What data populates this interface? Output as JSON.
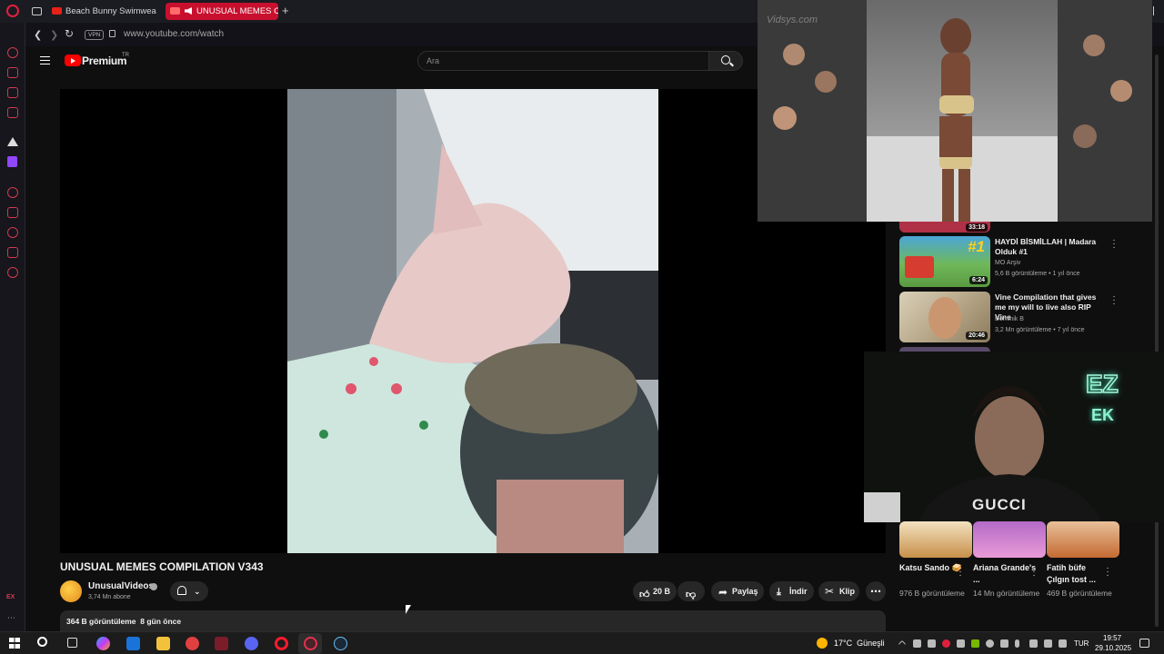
{
  "browser": {
    "tabs": [
      {
        "label": "Beach Bunny Swimwear I",
        "active": false
      },
      {
        "label": "UNUSUAL MEMES CO",
        "active": true
      }
    ],
    "new_tab_label": "+",
    "vpn_badge": "VPN",
    "url": "www.youtube.com/watch",
    "sidebar_bottom_text": "EX"
  },
  "youtube": {
    "logo_text": "Premium",
    "logo_sup": "TR",
    "search_placeholder": "Ara"
  },
  "video": {
    "title": "UNUSUAL MEMES COMPILATION V343",
    "channel_name": "UnusualVideos",
    "subscribers": "3,74 Mn abone",
    "likes": "20 B",
    "share_label": "Paylaş",
    "download_label": "İndir",
    "clip_label": "Klip",
    "description_meta": "364 B görüntüleme  8 gün önce"
  },
  "related": [
    {
      "duration_partial": "33:18"
    },
    {
      "title": "HAYDİ BİSMİLLAH | Madara Olduk #1",
      "channel": "MO Arşiv",
      "meta": "5,6 B görüntüleme • 1 yıl önce",
      "duration": "6:24",
      "thumb_text": "#1"
    },
    {
      "title": "Vine Compilation that gives me my will to live also RIP Vine",
      "channel": "Dominik B",
      "meta": "3,2 Mn görüntüleme • 7 yıl önce",
      "duration": "20:46"
    }
  ],
  "shorts": [
    {
      "title": "Katsu Sando 🥪",
      "meta": "976 B görüntüleme"
    },
    {
      "title": "Ariana Grande's ...",
      "meta": "14 Mn görüntüleme"
    },
    {
      "title": "Fatih büfe Çılgın tost ...",
      "meta": "469 B görüntüleme"
    }
  ],
  "overlays": {
    "pip_watermark": "Vidsys.com",
    "webcam_sign_top": "EZ",
    "webcam_sign_bottom": "EK",
    "webcam_shirt": "GUCCI"
  },
  "taskbar": {
    "weather": "17°C  Güneşli",
    "language": "TUR",
    "time": "19:57",
    "date": "29.10.2025"
  },
  "colors": {
    "opera_red": "#e0213c",
    "youtube_red": "#ff0000",
    "active_tab": "#c8102e"
  }
}
